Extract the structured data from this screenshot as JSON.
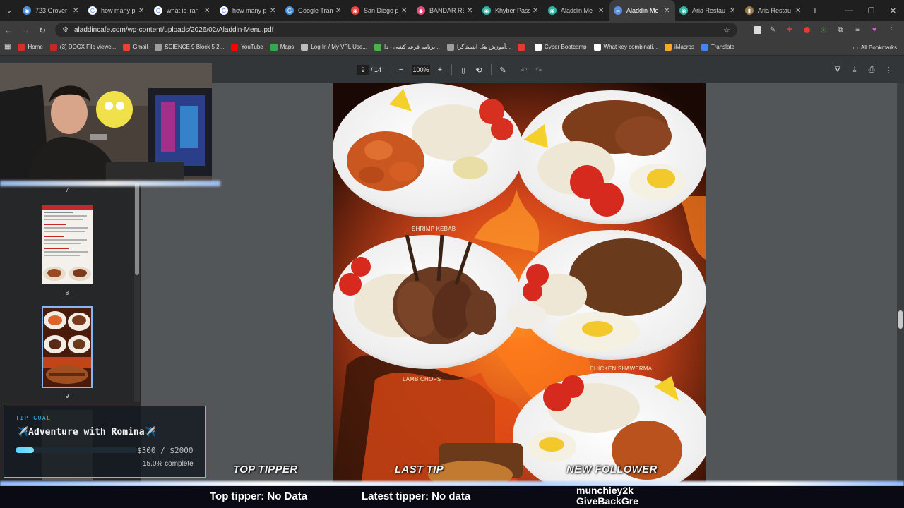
{
  "browser": {
    "tabs": [
      {
        "title": "723 Grover",
        "color": "#4a90e2",
        "glyph": "◉",
        "active": false
      },
      {
        "title": "how many p",
        "color": "#ffffff",
        "glyph": "G",
        "active": false
      },
      {
        "title": "what is iran",
        "color": "#ffffff",
        "glyph": "G",
        "active": false
      },
      {
        "title": "how many p",
        "color": "#ffffff",
        "glyph": "G",
        "active": false
      },
      {
        "title": "Google Tran",
        "color": "#4a90e2",
        "glyph": "G",
        "active": false
      },
      {
        "title": "San Diego p",
        "color": "#e8453c",
        "glyph": "◉",
        "active": false
      },
      {
        "title": "BANDAR RE",
        "color": "#e84a7a",
        "glyph": "◆",
        "active": false
      },
      {
        "title": "Khyber Pass",
        "color": "#2fb4a4",
        "glyph": "◉",
        "active": false
      },
      {
        "title": "Aladdin Me",
        "color": "#2fb4a4",
        "glyph": "◉",
        "active": false
      },
      {
        "title": "Aladdin-Me",
        "color": "#5f8fd8",
        "glyph": "∞",
        "active": true
      },
      {
        "title": "Aria Restau",
        "color": "#2fb4a4",
        "glyph": "◉",
        "active": false
      },
      {
        "title": "Aria Restau",
        "color": "#9a7a4a",
        "glyph": "▮",
        "active": false
      }
    ],
    "url": "aladdincafe.com/wp-content/uploads/2026/02/Aladdin-Menu.pdf",
    "bookmarks": [
      {
        "label": "Home",
        "color": "#d32f2f"
      },
      {
        "label": "(3) DOCX File viewe...",
        "color": "#c62828"
      },
      {
        "label": "Gmail",
        "color": "#ea4335"
      },
      {
        "label": "SCIENCE 9 Block 5 2...",
        "color": "#9e9e9e"
      },
      {
        "label": "YouTube",
        "color": "#ff0000"
      },
      {
        "label": "Maps",
        "color": "#34a853"
      },
      {
        "label": "Log In / My VPL Use...",
        "color": "#bdbdbd"
      },
      {
        "label": "برنامه قرعه کشی - دا...",
        "color": "#4caf50"
      },
      {
        "label": "آموزش هک اینستاگرا...",
        "color": "#9e9e9e"
      },
      {
        "label": "",
        "color": "#e53935"
      },
      {
        "label": "Cyber Bootcamp",
        "color": "#fafafa"
      },
      {
        "label": "What key combinati...",
        "color": "#ffffff"
      },
      {
        "label": "iMacros",
        "color": "#f9a825"
      },
      {
        "label": "Translate",
        "color": "#4285f4"
      }
    ],
    "all_bookmarks": "All Bookmarks"
  },
  "pdf": {
    "current_page": "9",
    "total_pages": "/ 14",
    "zoom": "100%",
    "thumbnails": [
      "7",
      "8",
      "9"
    ],
    "dishes": [
      {
        "label": "SHRIMP KEBAB"
      },
      {
        "label": "GYROS"
      },
      {
        "label": "LAMB CHOPS"
      },
      {
        "label": "CHICKEN SHAWERMA"
      }
    ]
  },
  "overlay": {
    "tip_goal": {
      "label": "TIP GOAL",
      "title": "✈️Adventure with Romina✈️",
      "amount": "$300 / $2000",
      "percent_text": "15.0% complete",
      "progress": 0.15,
      "accent": "#3ad4ff"
    },
    "headers": {
      "top_tipper": "TOP TIPPER",
      "last_tip": "LAST TIP",
      "new_follower": "NEW FOLLOWER"
    },
    "banner": {
      "top_tipper": "Top tipper: No Data",
      "latest_tipper": "Latest tipper: No data",
      "follower_line1": "munchiey2k",
      "follower_line2": "GiveBackGre"
    }
  }
}
